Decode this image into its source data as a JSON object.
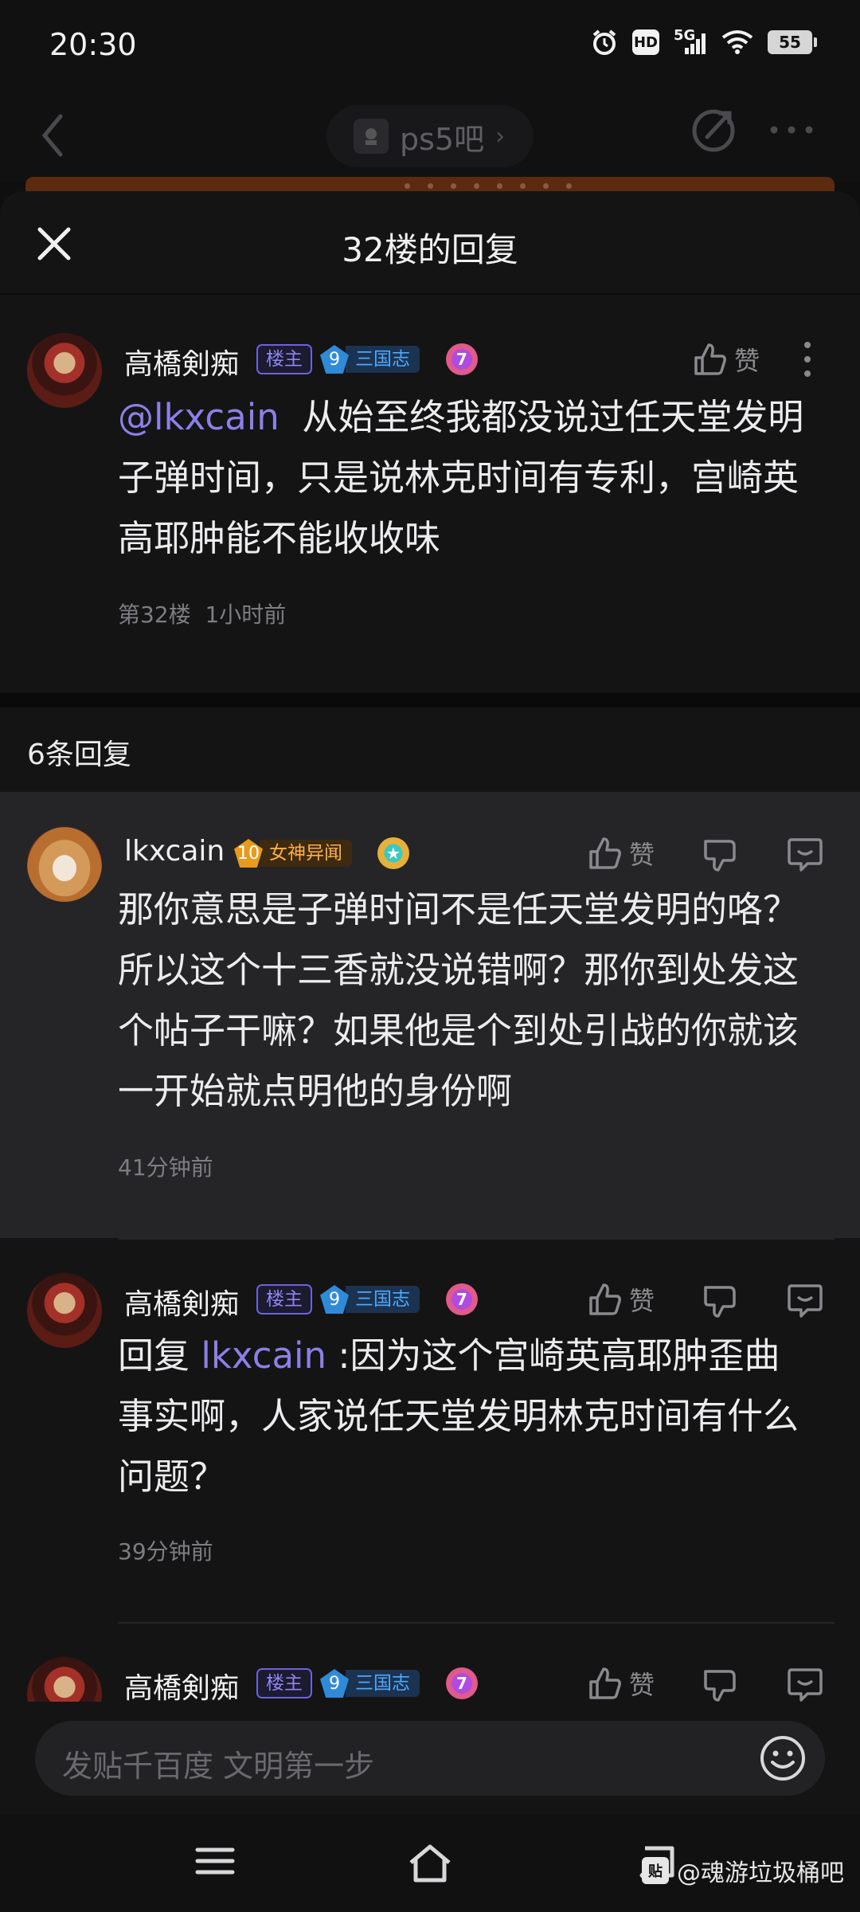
{
  "status_bar": {
    "time": "20:30",
    "hd": "HD",
    "network": "5G",
    "battery": "55"
  },
  "nav": {
    "forum_name": "ps5吧",
    "forum_chevron": "›"
  },
  "sheet": {
    "title": "32楼的回复"
  },
  "op": {
    "username": "高橋剣痴",
    "badge_owner": "楼主",
    "level": "9",
    "level_title": "三国志",
    "medal": "7",
    "like_label": "赞",
    "mention": "@lkxcain",
    "text_line1": "从始至终我都没说过任天堂发明",
    "text_line2": "子弹时间，只是说林克时间有专利，宫崎英",
    "text_line3": "高耶肿能不能收收味",
    "floor": "第32楼",
    "time": "1小时前"
  },
  "replies_count": "6条回复",
  "replies": [
    {
      "username": "lkxcain",
      "level": "10",
      "level_title": "女神异闻",
      "like_label": "赞",
      "line1": "那你意思是子弹时间不是任天堂发明的咯？",
      "line2": "所以这个十三香就没说错啊？那你到处发这",
      "line3": "个帖子干嘛？如果他是个到处引战的你就该",
      "line4": "一开始就点明他的身份啊",
      "time": "41分钟前"
    },
    {
      "username": "高橋剣痴",
      "badge_owner": "楼主",
      "level": "9",
      "level_title": "三国志",
      "medal": "7",
      "like_label": "赞",
      "reply_prefix": "回复",
      "mention": "lkxcain",
      "line1_rest": ":因为这个宫崎英高耶肿歪曲",
      "line2": "事实啊，人家说任天堂发明林克时间有什么",
      "line3": "问题？",
      "time": "39分钟前"
    },
    {
      "username": "高橋剣痴",
      "badge_owner": "楼主",
      "level": "9",
      "level_title": "三国志",
      "medal": "7",
      "like_label": "赞"
    }
  ],
  "input": {
    "placeholder": "发贴千百度 文明第一步"
  },
  "watermark": {
    "logo": "贴",
    "text": "@魂游垃圾桶吧"
  }
}
